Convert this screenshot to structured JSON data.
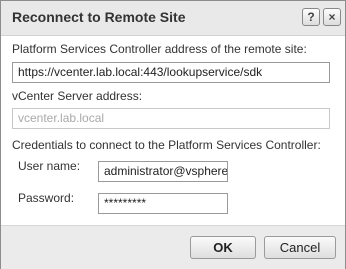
{
  "dialog": {
    "title": "Reconnect to Remote Site",
    "help_label": "?",
    "close_label": "×"
  },
  "form": {
    "psc_address_label": "Platform Services Controller address of the remote site:",
    "psc_address_value": "https://vcenter.lab.local:443/lookupservice/sdk",
    "vcenter_address_label": "vCenter Server address:",
    "vcenter_address_value": "vcenter.lab.local",
    "credentials_label": "Credentials to connect to the Platform Services Controller:",
    "username_label": "User name:",
    "username_value": "administrator@vsphere.local",
    "password_label": "Password:",
    "password_value": "*********"
  },
  "footer": {
    "ok_label": "OK",
    "cancel_label": "Cancel"
  }
}
